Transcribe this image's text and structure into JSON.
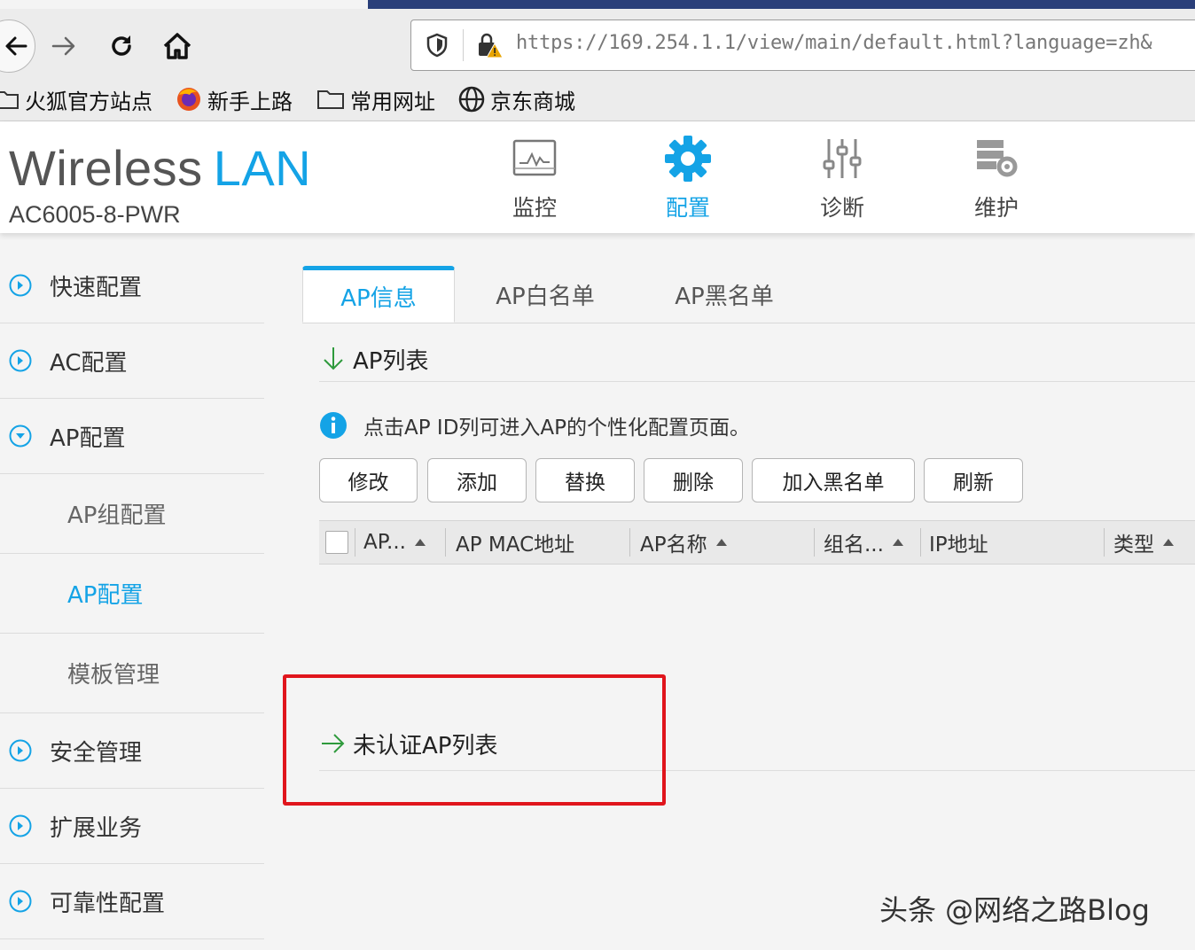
{
  "browser": {
    "url": "https://169.254.1.1/view/main/default.html?language=zh&",
    "bookmarks": [
      "火狐官方站点",
      "新手上路",
      "常用网址",
      "京东商城"
    ]
  },
  "app": {
    "brand_main": "Wireless",
    "brand_accent": "LAN",
    "model": "AC6005-8-PWR",
    "accent_color": "#14a3e6"
  },
  "topnav": {
    "monitor": "监控",
    "config": "配置",
    "diagnose": "诊断",
    "maintain": "维护"
  },
  "sidebar": {
    "items": [
      "快速配置",
      "AC配置",
      "AP配置"
    ],
    "sub_items": [
      "AP组配置",
      "AP配置",
      "模板管理"
    ],
    "items_after": [
      "安全管理",
      "扩展业务",
      "可靠性配置"
    ]
  },
  "tabs": [
    "AP信息",
    "AP白名单",
    "AP黑名单"
  ],
  "ap_list": {
    "title": "AP列表",
    "info": "点击AP ID列可进入AP的个性化配置页面。",
    "buttons": [
      "修改",
      "添加",
      "替换",
      "删除",
      "加入黑名单",
      "刷新"
    ],
    "columns": [
      "AP...",
      "AP MAC地址",
      "AP名称",
      "组名...",
      "IP地址",
      "类型"
    ]
  },
  "unauth_list": {
    "title": "未认证AP列表"
  },
  "watermark": "头条 @网络之路Blog"
}
